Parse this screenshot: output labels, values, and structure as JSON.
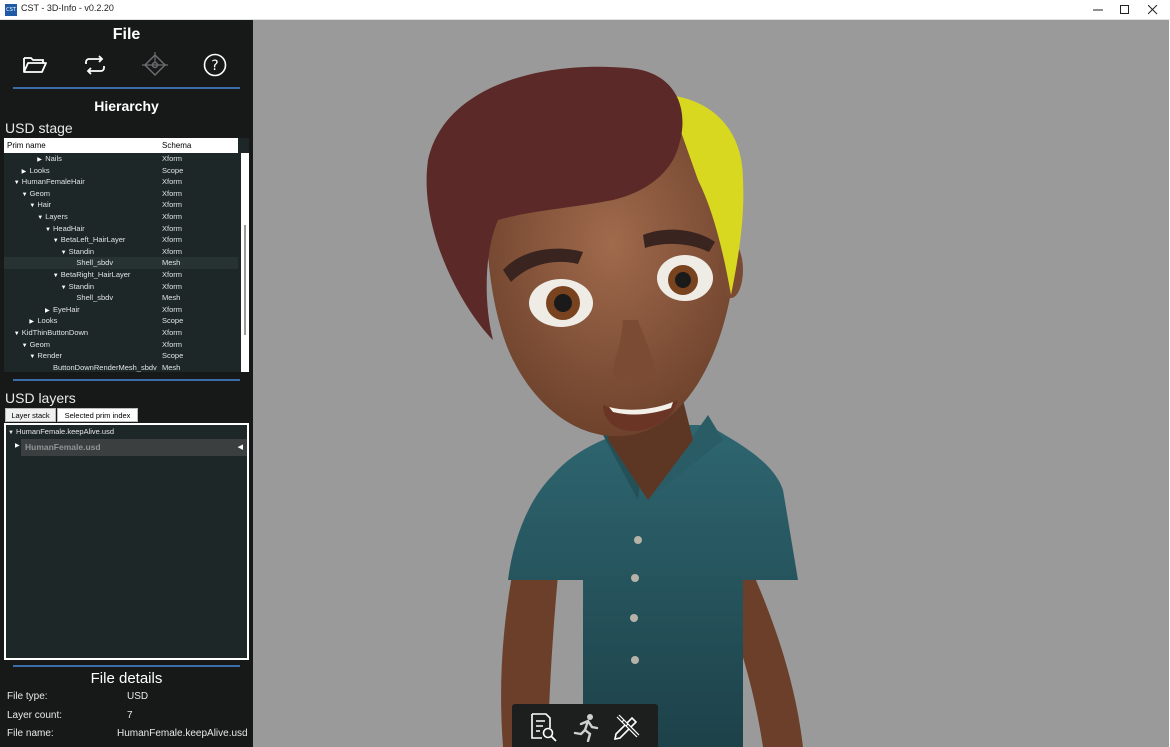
{
  "window": {
    "icon_text": "CST",
    "title": "CST - 3D-Info - v0.2.20",
    "controls": [
      "minimize-icon",
      "maximize-icon",
      "close-icon"
    ]
  },
  "file_section": {
    "title": "File",
    "toolbar_icons": [
      "folder-open-icon",
      "reload-icon",
      "usd-graph-icon",
      "help-icon"
    ]
  },
  "hierarchy": {
    "title": "Hierarchy",
    "stage_label": "USD stage",
    "columns": [
      "Prim name",
      "Schema"
    ],
    "rows": [
      {
        "name": "Nails",
        "schema": "Xform",
        "indent": 4,
        "expand": "collapsed"
      },
      {
        "name": "Looks",
        "schema": "Scope",
        "indent": 2,
        "expand": "collapsed"
      },
      {
        "name": "HumanFemaleHair",
        "schema": "Xform",
        "indent": 1,
        "expand": "expanded"
      },
      {
        "name": "Geom",
        "schema": "Xform",
        "indent": 2,
        "expand": "expanded"
      },
      {
        "name": "Hair",
        "schema": "Xform",
        "indent": 3,
        "expand": "expanded"
      },
      {
        "name": "Layers",
        "schema": "Xform",
        "indent": 4,
        "expand": "expanded"
      },
      {
        "name": "HeadHair",
        "schema": "Xform",
        "indent": 5,
        "expand": "expanded"
      },
      {
        "name": "BetaLeft_HairLayer",
        "schema": "Xform",
        "indent": 6,
        "expand": "expanded"
      },
      {
        "name": "Standin",
        "schema": "Xform",
        "indent": 7,
        "expand": "expanded"
      },
      {
        "name": "Shell_sbdv",
        "schema": "Mesh",
        "indent": 8,
        "expand": "none",
        "selected": true
      },
      {
        "name": "BetaRight_HairLayer",
        "schema": "Xform",
        "indent": 6,
        "expand": "expanded"
      },
      {
        "name": "Standin",
        "schema": "Xform",
        "indent": 7,
        "expand": "expanded"
      },
      {
        "name": "Shell_sbdv",
        "schema": "Mesh",
        "indent": 8,
        "expand": "none"
      },
      {
        "name": "EyeHair",
        "schema": "Xform",
        "indent": 5,
        "expand": "collapsed"
      },
      {
        "name": "Looks",
        "schema": "Scope",
        "indent": 3,
        "expand": "collapsed"
      },
      {
        "name": "KidThinButtonDown",
        "schema": "Xform",
        "indent": 1,
        "expand": "expanded"
      },
      {
        "name": "Geom",
        "schema": "Xform",
        "indent": 2,
        "expand": "expanded"
      },
      {
        "name": "Render",
        "schema": "Scope",
        "indent": 3,
        "expand": "expanded"
      },
      {
        "name": "ButtonDownRenderMesh_sbdv",
        "schema": "Mesh",
        "indent": 5,
        "expand": "none"
      }
    ]
  },
  "layers": {
    "label": "USD layers",
    "tabs": [
      "Layer stack",
      "Selected prim index"
    ],
    "active_tab": 0,
    "root_layer": "HumanFemale.keepAlive.usd",
    "sub_layer": "HumanFemale.usd"
  },
  "file_details": {
    "title": "File details",
    "items": [
      {
        "label": "File type:",
        "value": "USD"
      },
      {
        "label": "Layer count:",
        "value": "7"
      },
      {
        "label": "File name:",
        "value": "HumanFemale.keepAlive.usd"
      }
    ]
  },
  "viewport_tools": [
    "inspect-document-icon",
    "animation-icon",
    "edit-tools-icon"
  ],
  "colors": {
    "panel_bg": "#171919",
    "tree_bg": "#1e2728",
    "accent_divider": "#3b6ea8",
    "viewport_bg": "#9a9a9a"
  }
}
